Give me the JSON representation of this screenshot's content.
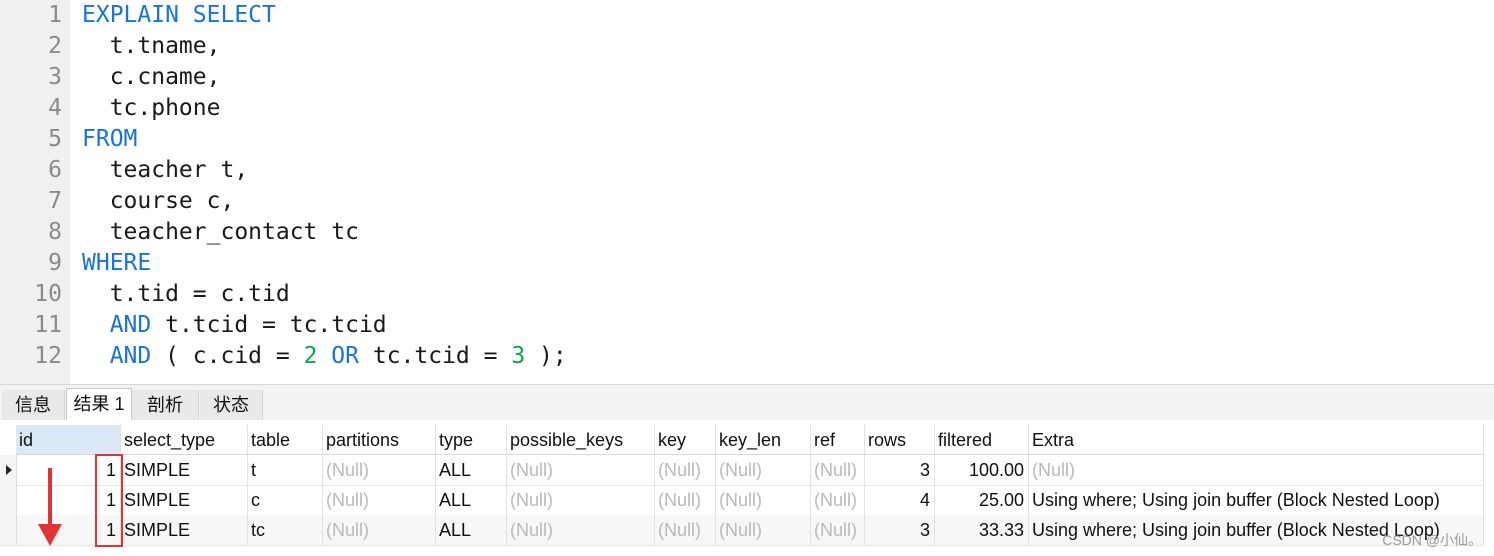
{
  "editor": {
    "lines": [
      {
        "n": "1",
        "segs": [
          {
            "t": "EXPLAIN SELECT",
            "k": "kw"
          }
        ]
      },
      {
        "n": "2",
        "segs": [
          {
            "t": "  t.tname,",
            "k": ""
          }
        ]
      },
      {
        "n": "3",
        "segs": [
          {
            "t": "  c.cname,",
            "k": ""
          }
        ]
      },
      {
        "n": "4",
        "segs": [
          {
            "t": "  tc.phone",
            "k": ""
          }
        ]
      },
      {
        "n": "5",
        "segs": [
          {
            "t": "FROM",
            "k": "kw"
          }
        ]
      },
      {
        "n": "6",
        "segs": [
          {
            "t": "  teacher t,",
            "k": ""
          }
        ]
      },
      {
        "n": "7",
        "segs": [
          {
            "t": "  course c,",
            "k": ""
          }
        ]
      },
      {
        "n": "8",
        "segs": [
          {
            "t": "  teacher_contact tc",
            "k": ""
          }
        ]
      },
      {
        "n": "9",
        "segs": [
          {
            "t": "WHERE",
            "k": "kw"
          }
        ]
      },
      {
        "n": "10",
        "segs": [
          {
            "t": "  t.tid = c.tid",
            "k": ""
          }
        ]
      },
      {
        "n": "11",
        "segs": [
          {
            "t": "  ",
            "k": ""
          },
          {
            "t": "AND",
            "k": "kw"
          },
          {
            "t": " t.tcid = tc.tcid",
            "k": ""
          }
        ]
      },
      {
        "n": "12",
        "segs": [
          {
            "t": "  ",
            "k": ""
          },
          {
            "t": "AND",
            "k": "kw"
          },
          {
            "t": " ( c.cid = ",
            "k": ""
          },
          {
            "t": "2",
            "k": "num"
          },
          {
            "t": " ",
            "k": ""
          },
          {
            "t": "OR",
            "k": "kw"
          },
          {
            "t": " tc.tcid = ",
            "k": ""
          },
          {
            "t": "3",
            "k": "num"
          },
          {
            "t": " );",
            "k": ""
          }
        ]
      }
    ]
  },
  "tabs": [
    {
      "label": "信息",
      "active": false
    },
    {
      "label": "结果 1",
      "active": true
    },
    {
      "label": "剖析",
      "active": false
    },
    {
      "label": "状态",
      "active": false
    }
  ],
  "grid": {
    "columns": [
      "id",
      "select_type",
      "table",
      "partitions",
      "type",
      "possible_keys",
      "key",
      "key_len",
      "ref",
      "rows",
      "filtered",
      "Extra"
    ],
    "rows": [
      [
        "1",
        "SIMPLE",
        "t",
        "(Null)",
        "ALL",
        "(Null)",
        "(Null)",
        "(Null)",
        "(Null)",
        "3",
        "100.00",
        "(Null)"
      ],
      [
        "1",
        "SIMPLE",
        "c",
        "(Null)",
        "ALL",
        "(Null)",
        "(Null)",
        "(Null)",
        "(Null)",
        "4",
        "25.00",
        "Using where; Using join buffer (Block Nested Loop)"
      ],
      [
        "1",
        "SIMPLE",
        "tc",
        "(Null)",
        "ALL",
        "(Null)",
        "(Null)",
        "(Null)",
        "(Null)",
        "3",
        "33.33",
        "Using where; Using join buffer (Block Nested Loop)"
      ]
    ]
  },
  "watermark": "CSDN @小仙。",
  "colors": {
    "keyword": "#1a73d9",
    "number": "#0aa84f",
    "annotation": "#e23434"
  }
}
